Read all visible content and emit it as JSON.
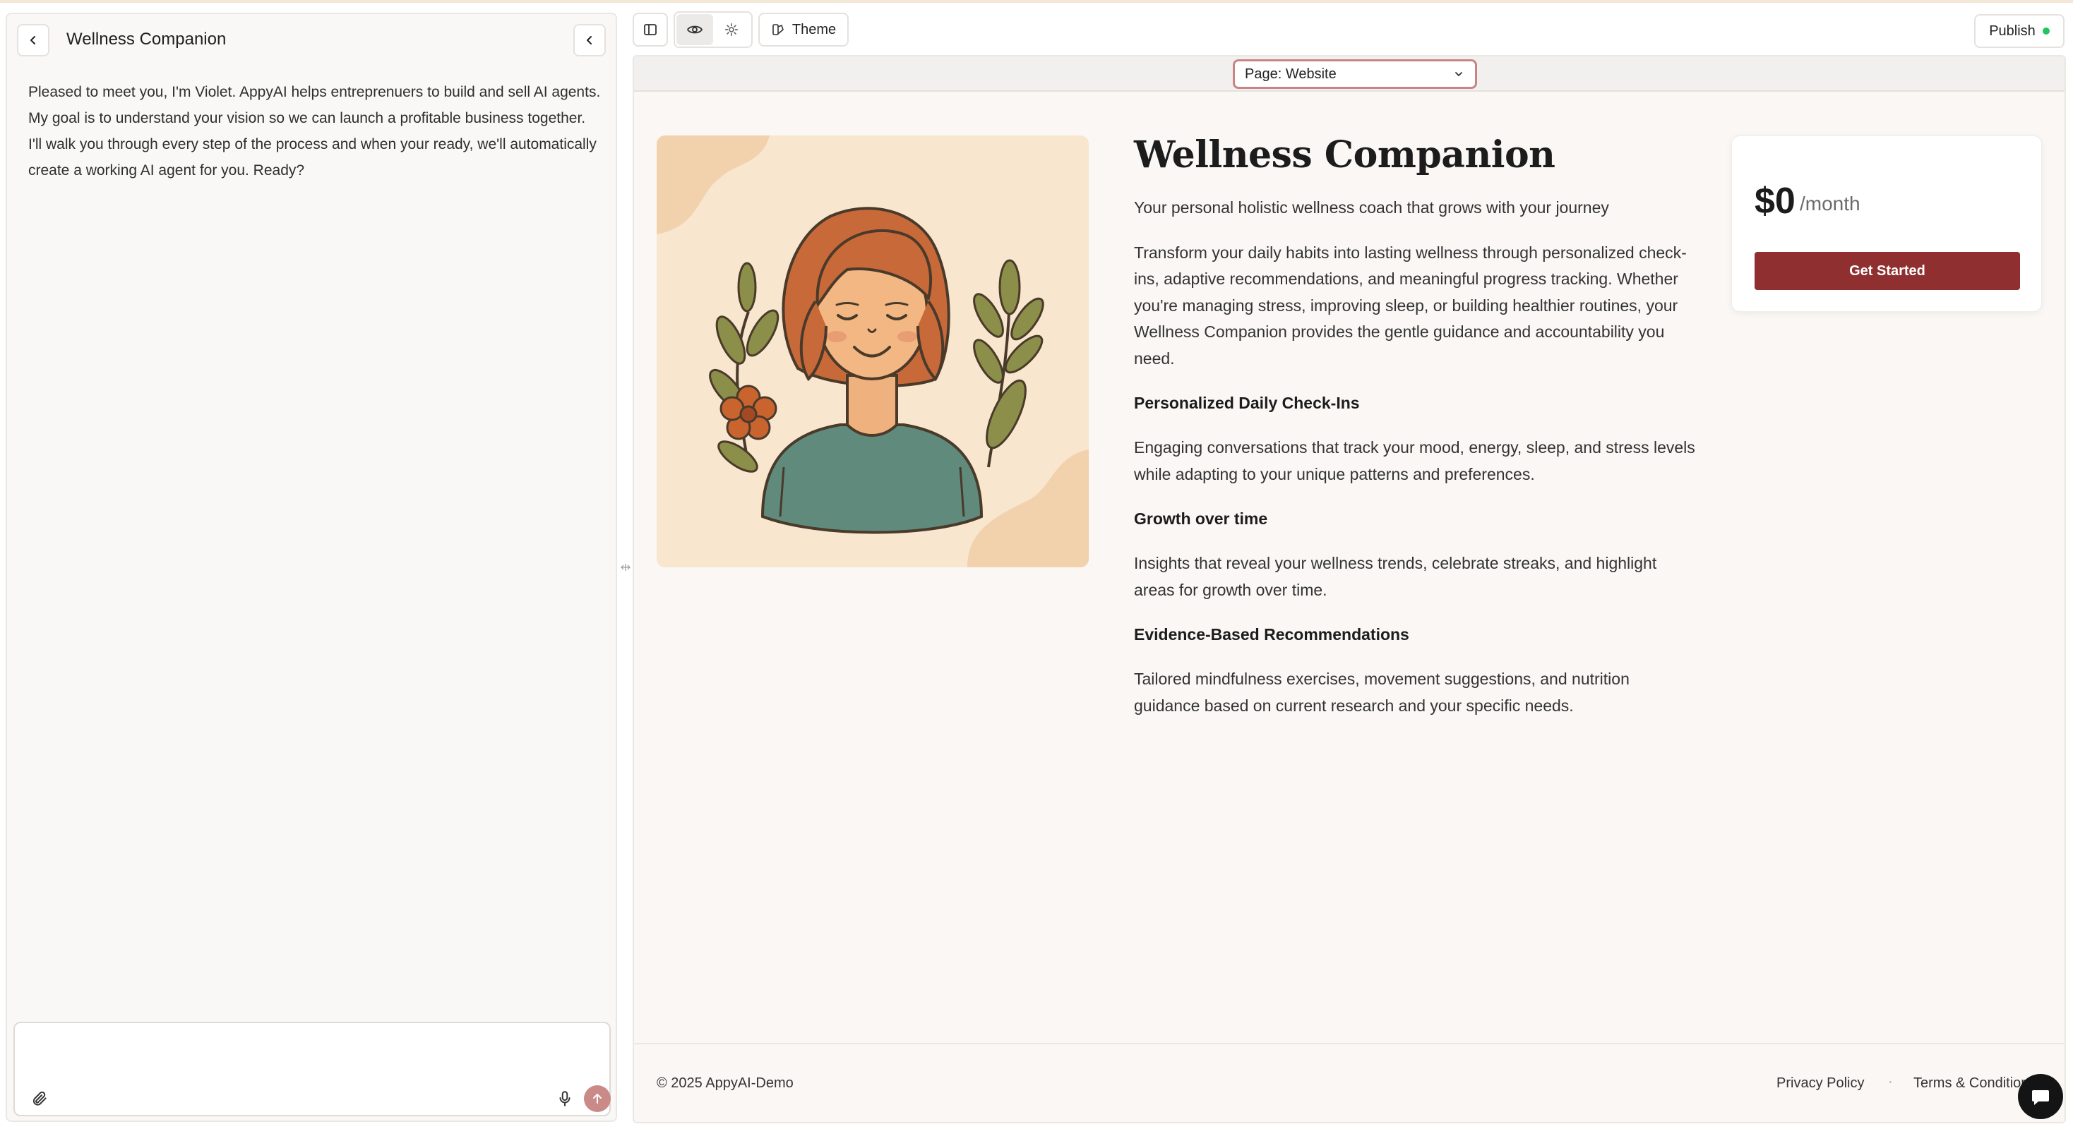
{
  "agent_panel": {
    "title": "Wellness Companion",
    "message": "Pleased to meet you, I'm Violet. AppyAI helps entreprenuers to build and sell AI agents. My goal is to understand your vision so we can launch a profitable business together. I'll walk you through every step of the process and when your ready, we'll automatically create a working AI agent for you. Ready?",
    "input_placeholder": ""
  },
  "toolbar": {
    "theme_label": "Theme",
    "publish_label": "Publish",
    "publish_status_color": "#22c55e"
  },
  "page_selector": {
    "value": "Page: Website"
  },
  "website": {
    "title": "Wellness Companion",
    "tagline": "Your personal holistic wellness coach that grows with your journey",
    "intro": "Transform your daily habits into lasting wellness through personalized check-ins, adaptive recommendations, and meaningful progress tracking. Whether you're managing stress, improving sleep, or building healthier routines, your Wellness Companion provides the gentle guidance and accountability you need.",
    "features": [
      {
        "heading": "Personalized Daily Check-Ins",
        "body": "Engaging conversations that track your mood, energy, sleep, and stress levels while adapting to your unique patterns and preferences."
      },
      {
        "heading": "Growth over time",
        "body": "Insights that reveal your wellness trends, celebrate streaks, and highlight areas for growth over time."
      },
      {
        "heading": "Evidence-Based Recommendations",
        "body": "Tailored mindfulness exercises, movement suggestions, and nutrition guidance based on current research and your specific needs."
      }
    ],
    "pricing": {
      "amount": "$0",
      "period": "/month",
      "cta": "Get Started"
    },
    "footer": {
      "copyright": "© 2025 AppyAI-Demo",
      "separator": "·",
      "privacy": "Privacy Policy",
      "terms": "Terms & Conditions"
    }
  },
  "colors": {
    "accent": "#8f2f2f",
    "send_button": "#c98a88",
    "page_background": "#faf7f4"
  }
}
